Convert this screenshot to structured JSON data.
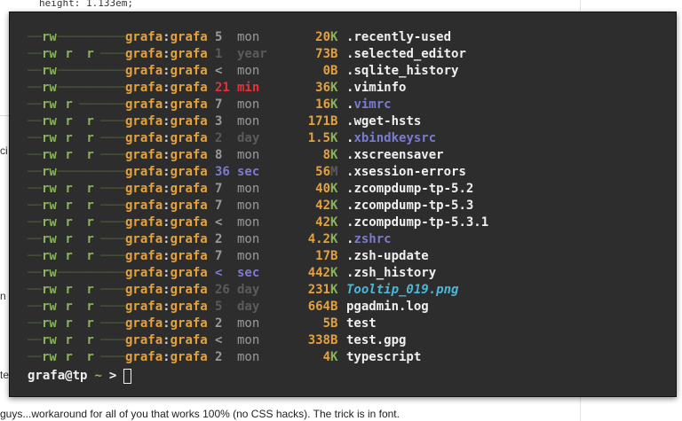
{
  "background": {
    "code_line": "height: 1.133em;",
    "frag_left_1": "ci",
    "frag_left_2": "n l",
    "frag_left_3": "te",
    "bottom_text": "guys...workaround for all of you that works 100% (no CSS hacks). The trick is in font."
  },
  "colors": {
    "terminal_bg": "#2d2d2d",
    "perm": "#8ab35c",
    "owner": "#e4a23e",
    "recent_time": "#e8303a",
    "dim_time": "#5b5b5b",
    "normal_time": "#9a9a9a",
    "blue_time": "#7b7bd0",
    "size_num": "#e4a23e",
    "file_default": "#f0f0f0",
    "file_dotconf": "#7b7bd0",
    "file_image": "#4ab8d8"
  },
  "terminal": {
    "files": [
      {
        "perm": [
          "rw",
          "",
          ""
        ],
        "owner": "grafa",
        "group": "grafa",
        "num": "5",
        "unit": "mon",
        "time_style": "normal",
        "size": "20",
        "suffix": "K",
        "name": "recently-used",
        "name_style": "default"
      },
      {
        "perm": [
          "rw",
          "r",
          "r"
        ],
        "owner": "grafa",
        "group": "grafa",
        "num": "1",
        "unit": "year",
        "time_style": "dim",
        "size": "73",
        "suffix": "B",
        "name": "selected_editor",
        "name_style": "default"
      },
      {
        "perm": [
          "rw",
          "",
          ""
        ],
        "owner": "grafa",
        "group": "grafa",
        "num": "<",
        "unit": "mon",
        "time_style": "normal",
        "size": "0",
        "suffix": "B",
        "name": "sqlite_history",
        "name_style": "default"
      },
      {
        "perm": [
          "rw",
          "",
          ""
        ],
        "owner": "grafa",
        "group": "grafa",
        "num": "21",
        "unit": "min",
        "time_style": "recent",
        "size": "36",
        "suffix": "K",
        "name": "viminfo",
        "name_style": "default"
      },
      {
        "perm": [
          "rw",
          "r",
          ""
        ],
        "owner": "grafa",
        "group": "grafa",
        "num": "7",
        "unit": "mon",
        "time_style": "normal",
        "size": "16",
        "suffix": "K",
        "name": "vimrc",
        "name_style": "dotconf"
      },
      {
        "perm": [
          "rw",
          "r",
          "r"
        ],
        "owner": "grafa",
        "group": "grafa",
        "num": "3",
        "unit": "mon",
        "time_style": "normal",
        "size": "171",
        "suffix": "B",
        "name": "wget-hsts",
        "name_style": "default"
      },
      {
        "perm": [
          "rw",
          "r",
          "r"
        ],
        "owner": "grafa",
        "group": "grafa",
        "num": "2",
        "unit": "day",
        "time_style": "dim",
        "size": "1.5",
        "suffix": "K",
        "name": "xbindkeysrc",
        "name_style": "dotconf"
      },
      {
        "perm": [
          "rw",
          "r",
          "r"
        ],
        "owner": "grafa",
        "group": "grafa",
        "num": "8",
        "unit": "mon",
        "time_style": "normal",
        "size": "8",
        "suffix": "K",
        "name": "xscreensaver",
        "name_style": "default"
      },
      {
        "perm": [
          "rw",
          "",
          ""
        ],
        "owner": "grafa",
        "group": "grafa",
        "num": "36",
        "unit": "sec",
        "time_style": "blue",
        "size": "56",
        "suffix": "M",
        "name": "xsession-errors",
        "name_style": "default"
      },
      {
        "perm": [
          "rw",
          "r",
          "r"
        ],
        "owner": "grafa",
        "group": "grafa",
        "num": "7",
        "unit": "mon",
        "time_style": "normal",
        "size": "40",
        "suffix": "K",
        "name": "zcompdump-tp-5.2",
        "name_style": "default"
      },
      {
        "perm": [
          "rw",
          "r",
          "r"
        ],
        "owner": "grafa",
        "group": "grafa",
        "num": "7",
        "unit": "mon",
        "time_style": "normal",
        "size": "42",
        "suffix": "K",
        "name": "zcompdump-tp-5.3",
        "name_style": "default"
      },
      {
        "perm": [
          "rw",
          "r",
          "r"
        ],
        "owner": "grafa",
        "group": "grafa",
        "num": "<",
        "unit": "mon",
        "time_style": "normal",
        "size": "42",
        "suffix": "K",
        "name": "zcompdump-tp-5.3.1",
        "name_style": "default"
      },
      {
        "perm": [
          "rw",
          "r",
          "r"
        ],
        "owner": "grafa",
        "group": "grafa",
        "num": "2",
        "unit": "mon",
        "time_style": "normal",
        "size": "4.2",
        "suffix": "K",
        "name": "zshrc",
        "name_style": "dotconf"
      },
      {
        "perm": [
          "rw",
          "r",
          "r"
        ],
        "owner": "grafa",
        "group": "grafa",
        "num": "7",
        "unit": "mon",
        "time_style": "normal",
        "size": "17",
        "suffix": "B",
        "name": "zsh-update",
        "name_style": "default"
      },
      {
        "perm": [
          "rw",
          "",
          ""
        ],
        "owner": "grafa",
        "group": "grafa",
        "num": "<",
        "unit": "sec",
        "time_style": "blue",
        "size": "442",
        "suffix": "K",
        "name": "zsh_history",
        "name_style": "default"
      },
      {
        "perm": [
          "rw",
          "r",
          "r"
        ],
        "owner": "grafa",
        "group": "grafa",
        "num": "26",
        "unit": "day",
        "time_style": "dim",
        "size": "231",
        "suffix": "K",
        "name": "Tooltip_019.png",
        "name_style": "image"
      },
      {
        "perm": [
          "rw",
          "r",
          "r"
        ],
        "owner": "grafa",
        "group": "grafa",
        "num": "5",
        "unit": "day",
        "time_style": "dim",
        "size": "664",
        "suffix": "B",
        "name": "pgadmin.log",
        "name_style": "default"
      },
      {
        "perm": [
          "rw",
          "r",
          "r"
        ],
        "owner": "grafa",
        "group": "grafa",
        "num": "2",
        "unit": "mon",
        "time_style": "normal",
        "size": "5",
        "suffix": "B",
        "name": "test",
        "name_style": "default"
      },
      {
        "perm": [
          "rw",
          "r",
          "r"
        ],
        "owner": "grafa",
        "group": "grafa",
        "num": "<",
        "unit": "mon",
        "time_style": "normal",
        "size": "338",
        "suffix": "B",
        "name": "test.gpg",
        "name_style": "default"
      },
      {
        "perm": [
          "rw",
          "r",
          "r"
        ],
        "owner": "grafa",
        "group": "grafa",
        "num": "2",
        "unit": "mon",
        "time_style": "normal",
        "size": "4",
        "suffix": "K",
        "name": "typescript",
        "name_style": "default"
      }
    ],
    "prompt": {
      "user_host": "grafa@tp",
      "path": "~",
      "symbol": ">"
    }
  }
}
